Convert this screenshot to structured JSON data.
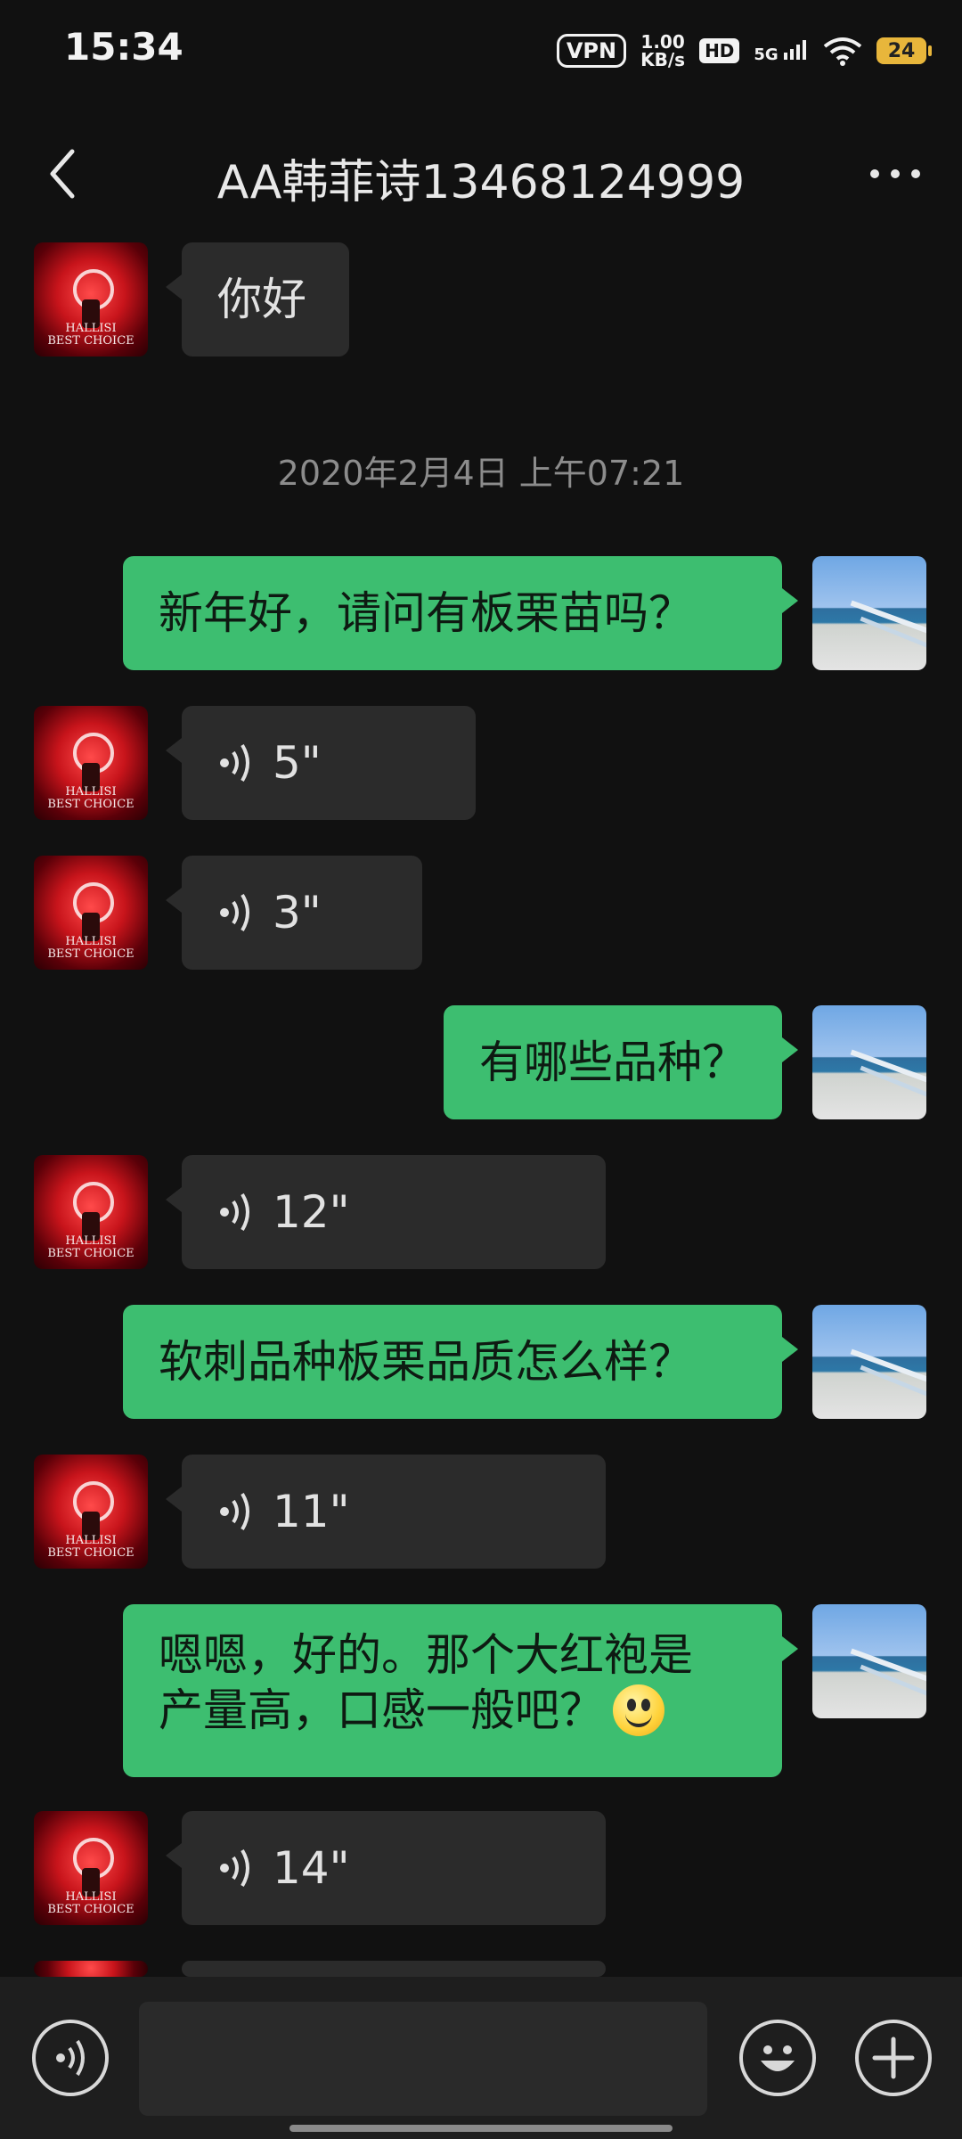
{
  "status_bar": {
    "time": "15:34",
    "vpn": "VPN",
    "speed_value": "1.00",
    "speed_unit": "KB/s",
    "hd": "HD",
    "network": "5G",
    "battery": "24"
  },
  "header": {
    "title": "AA韩菲诗13468124999"
  },
  "messages": [
    {
      "text": "你好"
    },
    {
      "timestamp": "2020年2月4日 上午07:21"
    },
    {
      "text": "新年好，请问有板栗苗吗？"
    },
    {
      "voice": "5\""
    },
    {
      "voice": "3\""
    },
    {
      "text": "有哪些品种？"
    },
    {
      "voice": "12\""
    },
    {
      "text": "软刺品种板栗品质怎么样？"
    },
    {
      "voice": "11\""
    },
    {
      "text_line1": "嗯嗯，好的。那个大红袍是",
      "text_line2": "产量高，口感一般吧？"
    },
    {
      "voice": "14\""
    }
  ],
  "avatar_text": "HALLISI\nBEST CHOICE",
  "colors": {
    "background": "#111111",
    "incoming_bubble": "#2b2b2b",
    "outgoing_bubble": "#3dbe70",
    "battery": "#e8b63b"
  },
  "icons": [
    "back-icon",
    "more-icon",
    "voice-icon",
    "emoji-icon",
    "plus-icon"
  ]
}
